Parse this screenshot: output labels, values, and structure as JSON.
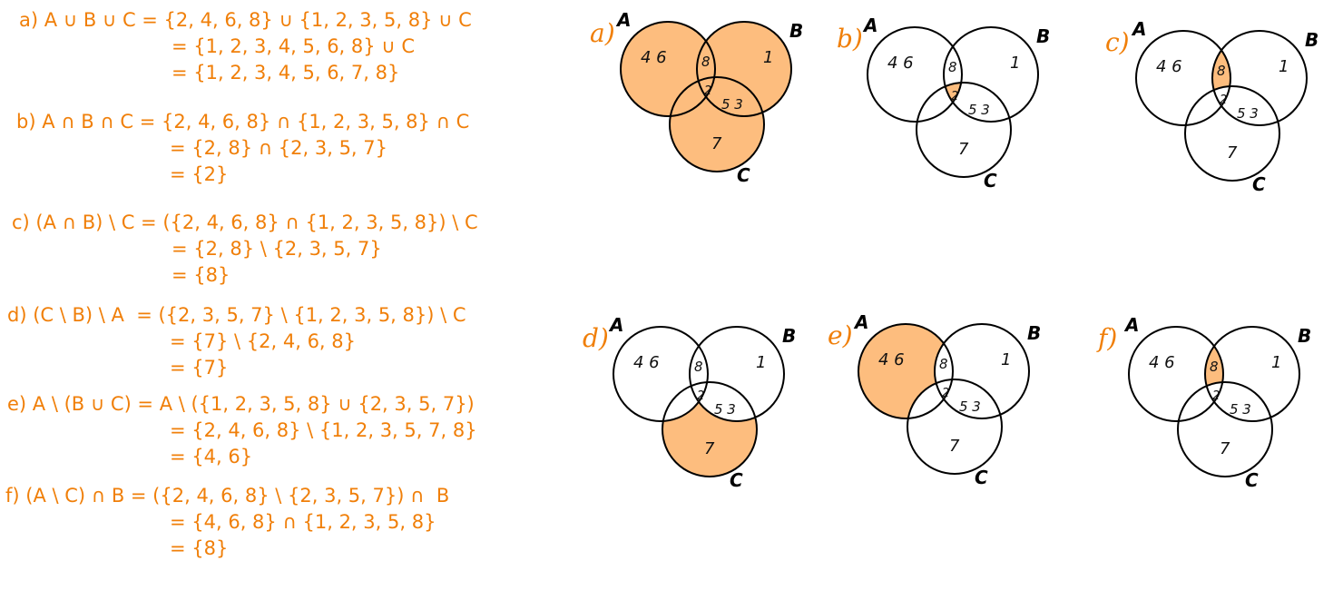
{
  "equations": [
    {
      "id": "a",
      "lines": [
        "a) A ∪ B ∪ C = {2, 4, 6, 8} ∪ {1, 2, 3, 5, 8} ∪ C",
        "= {1, 2, 3, 4, 5, 6, 8} ∪ C",
        "= {1, 2, 3, 4, 5, 6, 7, 8}"
      ]
    },
    {
      "id": "b",
      "lines": [
        "b) A ∩ B ∩ C = {2, 4, 6, 8} ∩ {1, 2, 3, 5, 8} ∩ C",
        "= {2, 8} ∩ {2, 3, 5, 7}",
        "= {2}"
      ]
    },
    {
      "id": "c",
      "lines": [
        "c) (A ∩ B) \\ C = ({2, 4, 6, 8} ∩ {1, 2, 3, 5, 8}) \\ C",
        "= {2, 8} \\ {2, 3, 5, 7}",
        "= {8}"
      ]
    },
    {
      "id": "d",
      "lines": [
        "d) (C \\ B) \\ A  = ({2, 3, 5, 7} \\ {1, 2, 3, 5, 8}) \\ C",
        "= {7} \\ {2, 4, 6, 8}",
        "= {7}"
      ]
    },
    {
      "id": "e",
      "lines": [
        "e) A \\ (B ∪ C) = A \\ ({1, 2, 3, 5, 8} ∪ {2, 3, 5, 7})",
        "= {2, 4, 6, 8} \\ {1, 2, 3, 5, 7, 8}",
        "= {4, 6}"
      ]
    },
    {
      "id": "f",
      "lines": [
        "f) (A \\ C) ∩ B = ({2, 4, 6, 8} \\ {2, 3, 5, 7}) ∩  B",
        "= {4, 6, 8} ∩ {1, 2, 3, 5, 8}",
        "= {8}"
      ]
    }
  ],
  "venn": {
    "set_labels": [
      "A",
      "B",
      "C"
    ],
    "region_numbers": {
      "a_only": "4  6",
      "ab_only": "8",
      "b_only": "1",
      "abc": "2",
      "bc_only": "5 3",
      "c_only": "7"
    },
    "panels": [
      {
        "id": "a",
        "label": "a)",
        "shaded": "A ∪ B ∪ C"
      },
      {
        "id": "b",
        "label": "b)",
        "shaded": "A ∩ B ∩ C"
      },
      {
        "id": "c",
        "label": "c)",
        "shaded": "(A ∩ B) \\ C"
      },
      {
        "id": "d",
        "label": "d)",
        "shaded": "(C \\ B) \\ A"
      },
      {
        "id": "e",
        "label": "e)",
        "shaded": "A \\ (B ∪ C)"
      },
      {
        "id": "f",
        "label": "f)",
        "shaded": "(A \\ C) ∩ B"
      }
    ]
  },
  "colors": {
    "text": "#f07f09",
    "shade": "#fdbd7e",
    "outline": "#000000"
  }
}
